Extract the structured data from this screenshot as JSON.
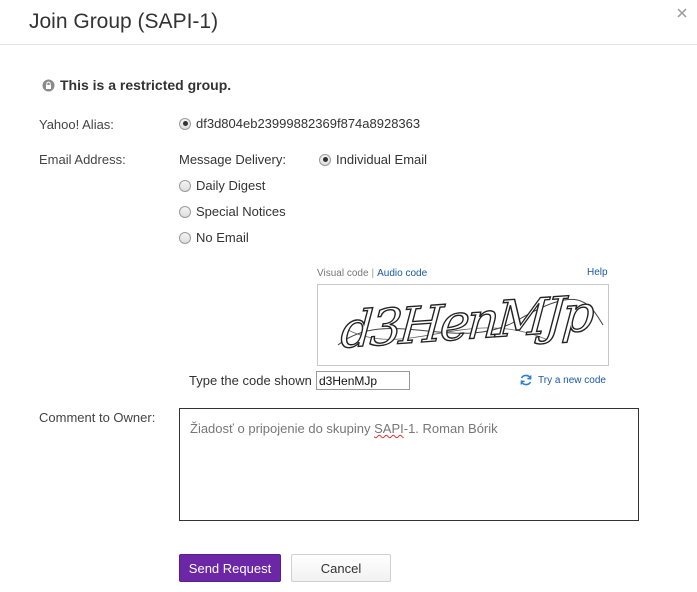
{
  "dialog": {
    "title": "Join Group (SAPI-1)",
    "close_icon": "close-icon"
  },
  "notice": {
    "text": "This is a restricted group.",
    "icon": "lock-icon"
  },
  "alias": {
    "label": "Yahoo! Alias:",
    "value": "df3d804eb23999882369f874a8928363",
    "selected": true
  },
  "email": {
    "label": "Email Address:",
    "delivery_label": "Message Delivery:",
    "options": [
      {
        "label": "Individual Email",
        "selected": true
      },
      {
        "label": "Daily Digest",
        "selected": false
      },
      {
        "label": "Special Notices",
        "selected": false
      },
      {
        "label": "No Email",
        "selected": false
      }
    ]
  },
  "captcha": {
    "visual_label": "Visual code",
    "audio_label": "Audio code",
    "help_label": "Help",
    "image_text": "d3HenMJp",
    "type_label": "Type the code shown",
    "input_value": "d3HenMJp",
    "refresh_label": "Try a new code",
    "refresh_icon": "refresh-icon"
  },
  "comment": {
    "label": "Comment to Owner:",
    "text_before": "Žiadosť o pripojenie do skupiny ",
    "text_err": "SAPI",
    "text_after": "-1. Roman Bórik"
  },
  "buttons": {
    "send": "Send Request",
    "cancel": "Cancel"
  },
  "colors": {
    "primary": "#6b27a6",
    "link": "#1a58a8"
  }
}
